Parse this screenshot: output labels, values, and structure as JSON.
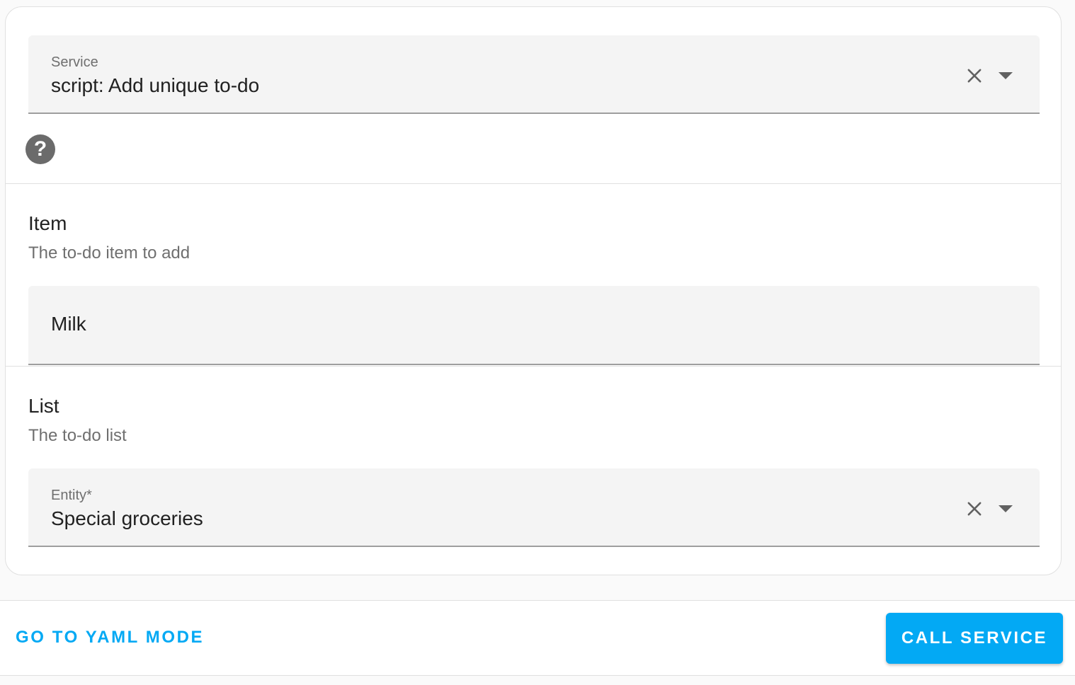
{
  "service_field": {
    "label": "Service",
    "value": "script: Add unique to-do"
  },
  "help": {
    "symbol": "?"
  },
  "item_section": {
    "title": "Item",
    "description": "The to-do item to add",
    "input_value": "Milk"
  },
  "list_section": {
    "title": "List",
    "description": "The to-do list",
    "entity_label": "Entity*",
    "entity_value": "Special groceries"
  },
  "footer": {
    "yaml_label": "GO TO YAML MODE",
    "call_label": "CALL SERVICE"
  },
  "colors": {
    "accent": "#03a9f4",
    "field_background": "#f4f4f4",
    "secondary_text": "#6f6f6f"
  },
  "icons": {
    "clear": "close-icon",
    "dropdown": "menu-down-icon",
    "help": "help-circle-icon"
  }
}
